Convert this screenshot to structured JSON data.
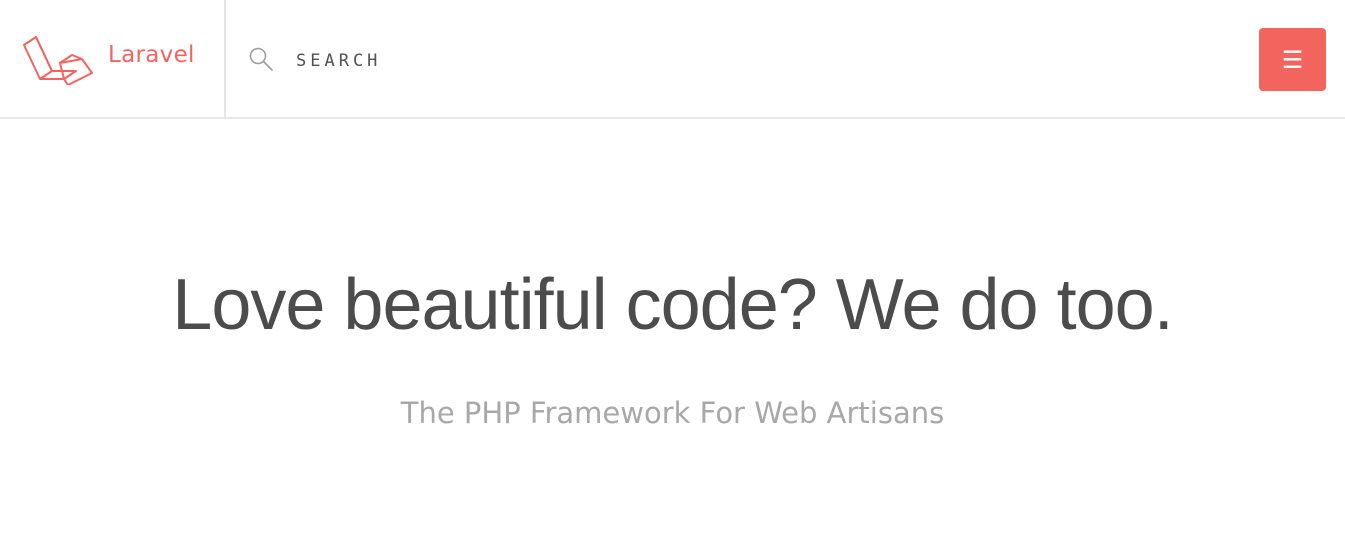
{
  "header": {
    "brand": {
      "name": "Laravel",
      "logo_icon": "laravel-logo-icon",
      "color": "#f4645f"
    },
    "search": {
      "icon": "search-icon",
      "placeholder": "SEARCH",
      "value": ""
    },
    "menu_button": {
      "icon": "hamburger-menu-icon",
      "label": "☰",
      "color": "#f4645f"
    }
  },
  "hero": {
    "title": "Love beautiful code? We do too.",
    "subtitle": "The PHP Framework For Web Artisans"
  },
  "colors": {
    "accent": "#f4645f",
    "title_text": "#4c4c4c",
    "subtitle_text": "#a8a8a8",
    "divider": "#e6e6e6"
  }
}
